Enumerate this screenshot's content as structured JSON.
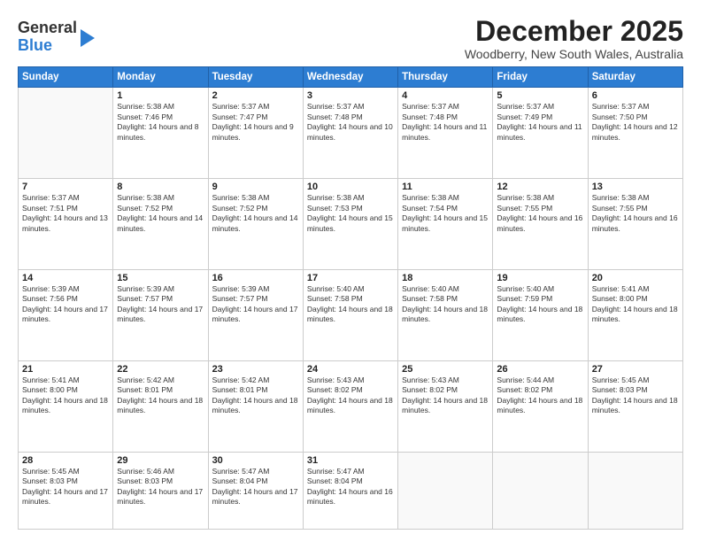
{
  "logo": {
    "general": "General",
    "blue": "Blue"
  },
  "title": "December 2025",
  "subtitle": "Woodberry, New South Wales, Australia",
  "days_of_week": [
    "Sunday",
    "Monday",
    "Tuesday",
    "Wednesday",
    "Thursday",
    "Friday",
    "Saturday"
  ],
  "weeks": [
    [
      {
        "day": "",
        "sunrise": "",
        "sunset": "",
        "daylight": ""
      },
      {
        "day": "1",
        "sunrise": "Sunrise: 5:38 AM",
        "sunset": "Sunset: 7:46 PM",
        "daylight": "Daylight: 14 hours and 8 minutes."
      },
      {
        "day": "2",
        "sunrise": "Sunrise: 5:37 AM",
        "sunset": "Sunset: 7:47 PM",
        "daylight": "Daylight: 14 hours and 9 minutes."
      },
      {
        "day": "3",
        "sunrise": "Sunrise: 5:37 AM",
        "sunset": "Sunset: 7:48 PM",
        "daylight": "Daylight: 14 hours and 10 minutes."
      },
      {
        "day": "4",
        "sunrise": "Sunrise: 5:37 AM",
        "sunset": "Sunset: 7:48 PM",
        "daylight": "Daylight: 14 hours and 11 minutes."
      },
      {
        "day": "5",
        "sunrise": "Sunrise: 5:37 AM",
        "sunset": "Sunset: 7:49 PM",
        "daylight": "Daylight: 14 hours and 11 minutes."
      },
      {
        "day": "6",
        "sunrise": "Sunrise: 5:37 AM",
        "sunset": "Sunset: 7:50 PM",
        "daylight": "Daylight: 14 hours and 12 minutes."
      }
    ],
    [
      {
        "day": "7",
        "sunrise": "Sunrise: 5:37 AM",
        "sunset": "Sunset: 7:51 PM",
        "daylight": "Daylight: 14 hours and 13 minutes."
      },
      {
        "day": "8",
        "sunrise": "Sunrise: 5:38 AM",
        "sunset": "Sunset: 7:52 PM",
        "daylight": "Daylight: 14 hours and 14 minutes."
      },
      {
        "day": "9",
        "sunrise": "Sunrise: 5:38 AM",
        "sunset": "Sunset: 7:52 PM",
        "daylight": "Daylight: 14 hours and 14 minutes."
      },
      {
        "day": "10",
        "sunrise": "Sunrise: 5:38 AM",
        "sunset": "Sunset: 7:53 PM",
        "daylight": "Daylight: 14 hours and 15 minutes."
      },
      {
        "day": "11",
        "sunrise": "Sunrise: 5:38 AM",
        "sunset": "Sunset: 7:54 PM",
        "daylight": "Daylight: 14 hours and 15 minutes."
      },
      {
        "day": "12",
        "sunrise": "Sunrise: 5:38 AM",
        "sunset": "Sunset: 7:55 PM",
        "daylight": "Daylight: 14 hours and 16 minutes."
      },
      {
        "day": "13",
        "sunrise": "Sunrise: 5:38 AM",
        "sunset": "Sunset: 7:55 PM",
        "daylight": "Daylight: 14 hours and 16 minutes."
      }
    ],
    [
      {
        "day": "14",
        "sunrise": "Sunrise: 5:39 AM",
        "sunset": "Sunset: 7:56 PM",
        "daylight": "Daylight: 14 hours and 17 minutes."
      },
      {
        "day": "15",
        "sunrise": "Sunrise: 5:39 AM",
        "sunset": "Sunset: 7:57 PM",
        "daylight": "Daylight: 14 hours and 17 minutes."
      },
      {
        "day": "16",
        "sunrise": "Sunrise: 5:39 AM",
        "sunset": "Sunset: 7:57 PM",
        "daylight": "Daylight: 14 hours and 17 minutes."
      },
      {
        "day": "17",
        "sunrise": "Sunrise: 5:40 AM",
        "sunset": "Sunset: 7:58 PM",
        "daylight": "Daylight: 14 hours and 18 minutes."
      },
      {
        "day": "18",
        "sunrise": "Sunrise: 5:40 AM",
        "sunset": "Sunset: 7:58 PM",
        "daylight": "Daylight: 14 hours and 18 minutes."
      },
      {
        "day": "19",
        "sunrise": "Sunrise: 5:40 AM",
        "sunset": "Sunset: 7:59 PM",
        "daylight": "Daylight: 14 hours and 18 minutes."
      },
      {
        "day": "20",
        "sunrise": "Sunrise: 5:41 AM",
        "sunset": "Sunset: 8:00 PM",
        "daylight": "Daylight: 14 hours and 18 minutes."
      }
    ],
    [
      {
        "day": "21",
        "sunrise": "Sunrise: 5:41 AM",
        "sunset": "Sunset: 8:00 PM",
        "daylight": "Daylight: 14 hours and 18 minutes."
      },
      {
        "day": "22",
        "sunrise": "Sunrise: 5:42 AM",
        "sunset": "Sunset: 8:01 PM",
        "daylight": "Daylight: 14 hours and 18 minutes."
      },
      {
        "day": "23",
        "sunrise": "Sunrise: 5:42 AM",
        "sunset": "Sunset: 8:01 PM",
        "daylight": "Daylight: 14 hours and 18 minutes."
      },
      {
        "day": "24",
        "sunrise": "Sunrise: 5:43 AM",
        "sunset": "Sunset: 8:02 PM",
        "daylight": "Daylight: 14 hours and 18 minutes."
      },
      {
        "day": "25",
        "sunrise": "Sunrise: 5:43 AM",
        "sunset": "Sunset: 8:02 PM",
        "daylight": "Daylight: 14 hours and 18 minutes."
      },
      {
        "day": "26",
        "sunrise": "Sunrise: 5:44 AM",
        "sunset": "Sunset: 8:02 PM",
        "daylight": "Daylight: 14 hours and 18 minutes."
      },
      {
        "day": "27",
        "sunrise": "Sunrise: 5:45 AM",
        "sunset": "Sunset: 8:03 PM",
        "daylight": "Daylight: 14 hours and 18 minutes."
      }
    ],
    [
      {
        "day": "28",
        "sunrise": "Sunrise: 5:45 AM",
        "sunset": "Sunset: 8:03 PM",
        "daylight": "Daylight: 14 hours and 17 minutes."
      },
      {
        "day": "29",
        "sunrise": "Sunrise: 5:46 AM",
        "sunset": "Sunset: 8:03 PM",
        "daylight": "Daylight: 14 hours and 17 minutes."
      },
      {
        "day": "30",
        "sunrise": "Sunrise: 5:47 AM",
        "sunset": "Sunset: 8:04 PM",
        "daylight": "Daylight: 14 hours and 17 minutes."
      },
      {
        "day": "31",
        "sunrise": "Sunrise: 5:47 AM",
        "sunset": "Sunset: 8:04 PM",
        "daylight": "Daylight: 14 hours and 16 minutes."
      },
      {
        "day": "",
        "sunrise": "",
        "sunset": "",
        "daylight": ""
      },
      {
        "day": "",
        "sunrise": "",
        "sunset": "",
        "daylight": ""
      },
      {
        "day": "",
        "sunrise": "",
        "sunset": "",
        "daylight": ""
      }
    ]
  ]
}
